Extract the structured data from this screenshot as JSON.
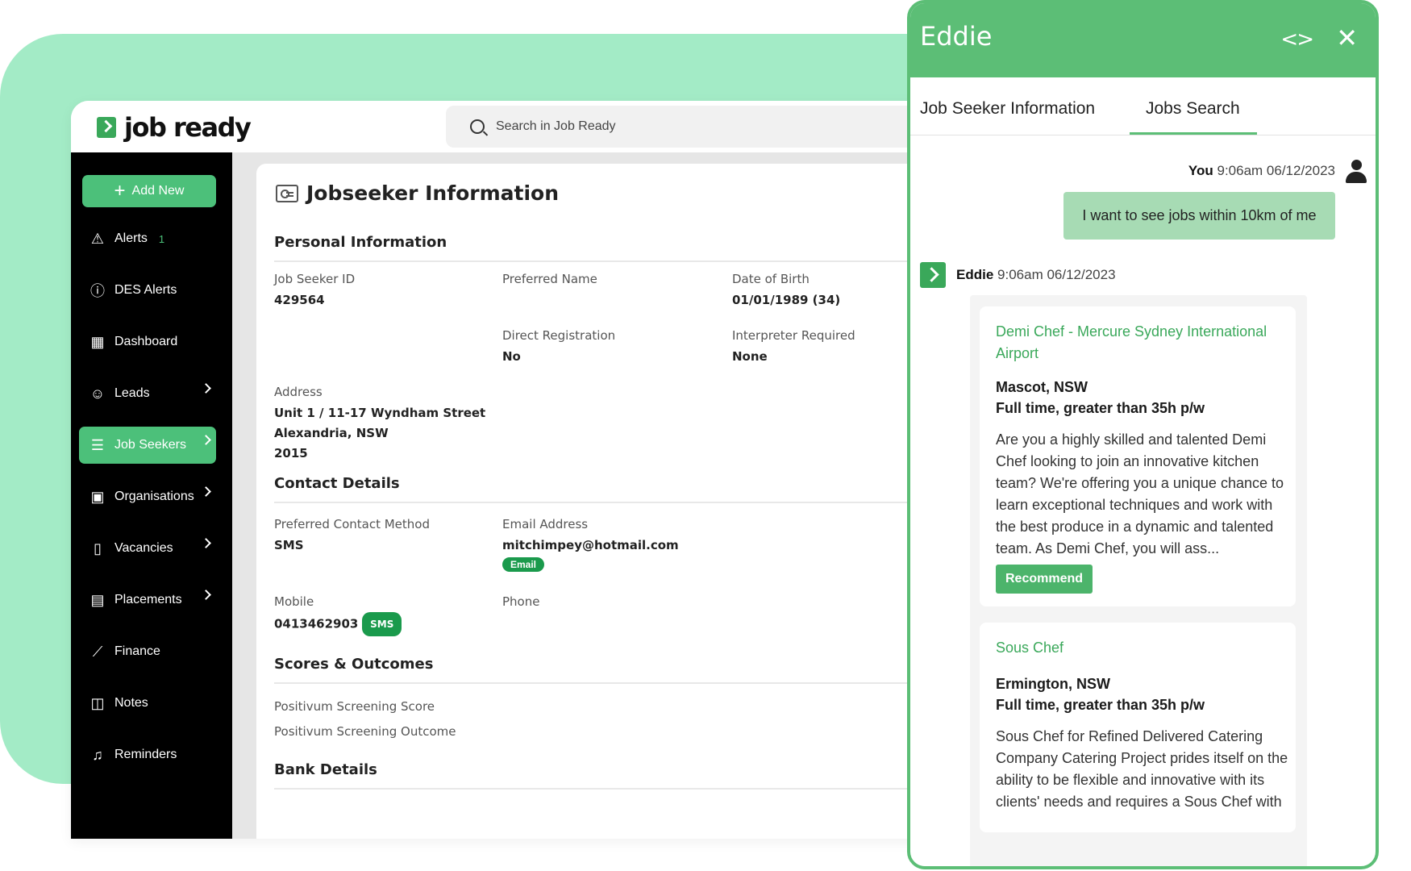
{
  "app": {
    "logo_text": "job ready",
    "search_placeholder": "Search in Job Ready"
  },
  "sidebar": {
    "add_new": "Add New",
    "items": [
      {
        "label": "Alerts",
        "icon": "warning-icon",
        "count": "1",
        "chevron": false
      },
      {
        "label": "DES Alerts",
        "icon": "info-circle-icon",
        "chevron": false
      },
      {
        "label": "Dashboard",
        "icon": "grid-icon",
        "chevron": false
      },
      {
        "label": "Leads",
        "icon": "user-plus-icon",
        "chevron": true
      },
      {
        "label": "Job Seekers",
        "icon": "users-list-icon",
        "chevron": true,
        "active": true
      },
      {
        "label": "Organisations",
        "icon": "building-icon",
        "chevron": true
      },
      {
        "label": "Vacancies",
        "icon": "document-icon",
        "chevron": true
      },
      {
        "label": "Placements",
        "icon": "clipboard-icon",
        "chevron": true
      },
      {
        "label": "Finance",
        "icon": "chart-icon",
        "chevron": false
      },
      {
        "label": "Notes",
        "icon": "book-icon",
        "chevron": false
      },
      {
        "label": "Reminders",
        "icon": "bell-icon",
        "chevron": false
      }
    ]
  },
  "page": {
    "title": "Jobseeker Information",
    "sections": {
      "personal": "Personal Information",
      "contact": "Contact Details",
      "scores": "Scores & Outcomes",
      "bank": "Bank Details"
    },
    "fields": {
      "job_seeker_id": {
        "label": "Job Seeker ID",
        "value": "429564"
      },
      "preferred_name": {
        "label": "Preferred Name",
        "value": ""
      },
      "dob": {
        "label": "Date of Birth",
        "value": "01/01/1989 (34)"
      },
      "direct_registration": {
        "label": "Direct Registration",
        "value": "No"
      },
      "interpreter": {
        "label": "Interpreter Required",
        "value": "None"
      },
      "address": {
        "label": "Address",
        "line1": "Unit 1 / 11-17 Wyndham Street",
        "line2": "Alexandria, NSW",
        "line3": "2015"
      },
      "contact_method": {
        "label": "Preferred Contact Method",
        "value": "SMS"
      },
      "email": {
        "label": "Email Address",
        "value": "mitchimpey@hotmail.com",
        "badge": "Email"
      },
      "mobile": {
        "label": "Mobile",
        "value": "0413462903",
        "badge": "SMS"
      },
      "phone": {
        "label": "Phone",
        "value": ""
      },
      "screening_score": {
        "label": "Positivum Screening Score"
      },
      "screening_outcome": {
        "label": "Positivum Screening Outcome"
      }
    }
  },
  "eddie": {
    "title": "Eddie",
    "tabs": [
      "Job Seeker Information",
      "Jobs Search"
    ],
    "active_tab": "Jobs Search",
    "user_name": "You",
    "user_time": "9:06am 06/12/2023",
    "user_message": "I want to see jobs within 10km of me",
    "bot_name": "Eddie",
    "bot_time": "9:06am 06/12/2023",
    "jobs": [
      {
        "title": "Demi Chef - Mercure Sydney International Airport",
        "location": "Mascot, NSW",
        "type": "Full time, greater than 35h p/w",
        "description": "Are you a highly skilled and talented Demi Chef looking to join an innovative kitchen team? We're offering you a unique chance to learn exceptional techniques and work with the best produce in a dynamic and talented team. As Demi Chef, you will ass...",
        "action": "Recommend"
      },
      {
        "title": "Sous Chef",
        "location": "Ermington, NSW",
        "type": "Full time, greater than 35h p/w",
        "description": "Sous Chef for Refined Delivered Catering Company Catering Project prides itself on the ability to be flexible and innovative with its clients' needs and requires a Sous Chef with"
      }
    ]
  },
  "colors": {
    "brand_green": "#5cbe76",
    "background_mint": "#a3ebc6",
    "sidebar_black": "#000000",
    "link_green": "#3aa85a"
  }
}
